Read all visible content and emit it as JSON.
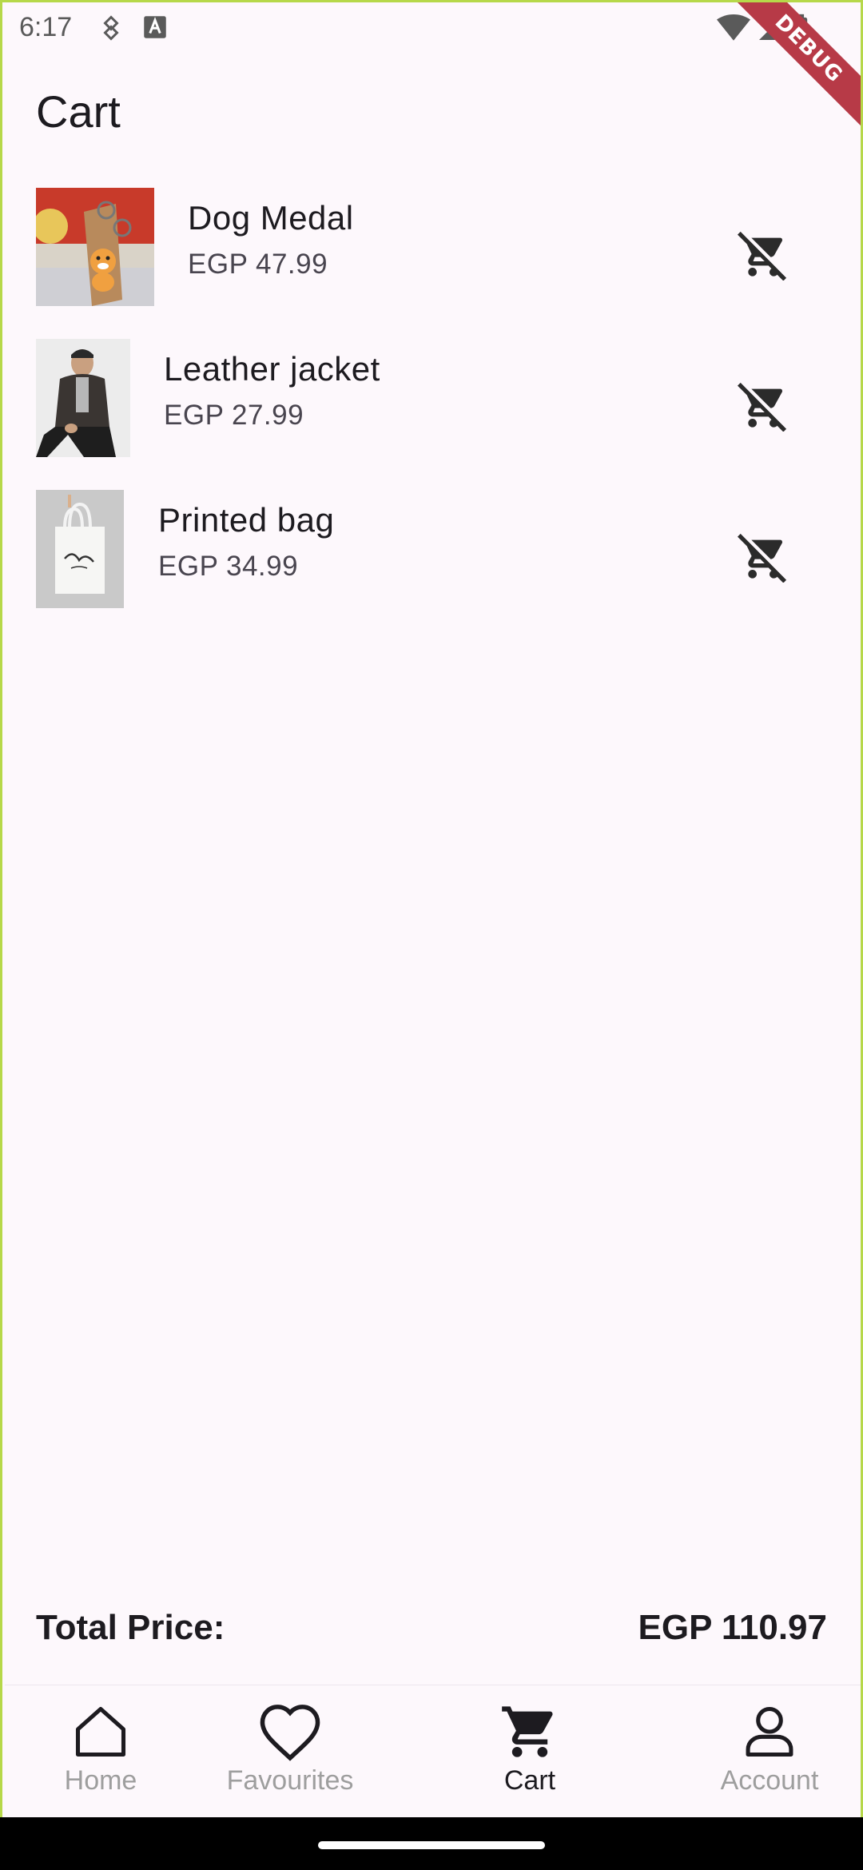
{
  "status_bar": {
    "time": "6:17"
  },
  "debug_banner": "DEBUG",
  "page": {
    "title": "Cart"
  },
  "cart": {
    "items": [
      {
        "name": "Dog Medal",
        "price": "EGP 47.99",
        "image": "dog-medal-keychain"
      },
      {
        "name": "Leather jacket",
        "price": "EGP 27.99",
        "image": "leather-jacket-model"
      },
      {
        "name": "Printed bag",
        "price": "EGP 34.99",
        "image": "printed-tote-bag"
      }
    ],
    "remove_icon": "remove-shopping-cart-icon"
  },
  "total": {
    "label": "Total Price:",
    "value": "EGP 110.97"
  },
  "nav": {
    "items": [
      {
        "label": "Home",
        "icon": "home-icon",
        "active": false
      },
      {
        "label": "Favourites",
        "icon": "heart-icon",
        "active": false
      },
      {
        "label": "Cart",
        "icon": "cart-icon",
        "active": true
      },
      {
        "label": "Account",
        "icon": "person-icon",
        "active": false
      }
    ]
  },
  "colors": {
    "accent": "#1d1b20",
    "inactive": "#9e9e9e",
    "background": "#fdf8fc",
    "debug": "#b73a47"
  }
}
